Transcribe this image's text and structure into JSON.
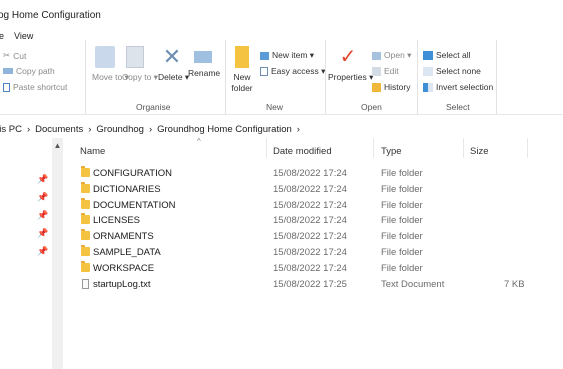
{
  "window": {
    "title": "og Home Configuration"
  },
  "tabs": [
    "e",
    "View"
  ],
  "ribbon": {
    "clipboard": {
      "cut": "Cut",
      "copy_path": "Copy path",
      "paste_shortcut": "Paste shortcut"
    },
    "organise": {
      "label": "Organise",
      "move_to": "Move to ▾",
      "copy_to": "Copy to ▾",
      "delete": "Delete ▾",
      "rename": "Rename"
    },
    "new": {
      "label": "New",
      "new_folder": "New folder",
      "new_item": "New item ▾",
      "easy_access": "Easy access ▾"
    },
    "open": {
      "label": "Open",
      "properties": "Properties ▾",
      "open": "Open ▾",
      "edit": "Edit",
      "history": "History"
    },
    "select": {
      "label": "Select",
      "select_all": "Select all",
      "select_none": "Select none",
      "invert_selection": "Invert selection"
    }
  },
  "breadcrumb": [
    "his PC",
    "Documents",
    "Groundhog",
    "Groundhog Home Configuration"
  ],
  "columns": {
    "name": "Name",
    "date": "Date modified",
    "type": "Type",
    "size": "Size"
  },
  "files": [
    {
      "name": "CONFIGURATION",
      "date": "15/08/2022 17:24",
      "type": "File folder",
      "size": "",
      "icon": "folder-icon"
    },
    {
      "name": "DICTIONARIES",
      "date": "15/08/2022 17:24",
      "type": "File folder",
      "size": "",
      "icon": "folder-icon"
    },
    {
      "name": "DOCUMENTATION",
      "date": "15/08/2022 17:24",
      "type": "File folder",
      "size": "",
      "icon": "folder-icon"
    },
    {
      "name": "LICENSES",
      "date": "15/08/2022 17:24",
      "type": "File folder",
      "size": "",
      "icon": "folder-icon"
    },
    {
      "name": "ORNAMENTS",
      "date": "15/08/2022 17:24",
      "type": "File folder",
      "size": "",
      "icon": "folder-icon"
    },
    {
      "name": "SAMPLE_DATA",
      "date": "15/08/2022 17:24",
      "type": "File folder",
      "size": "",
      "icon": "folder-icon"
    },
    {
      "name": "WORKSPACE",
      "date": "15/08/2022 17:24",
      "type": "File folder",
      "size": "",
      "icon": "folder-icon"
    },
    {
      "name": "startupLog.txt",
      "date": "15/08/2022 17:25",
      "type": "Text Document",
      "size": "7 KB",
      "icon": "text-file-icon"
    }
  ]
}
